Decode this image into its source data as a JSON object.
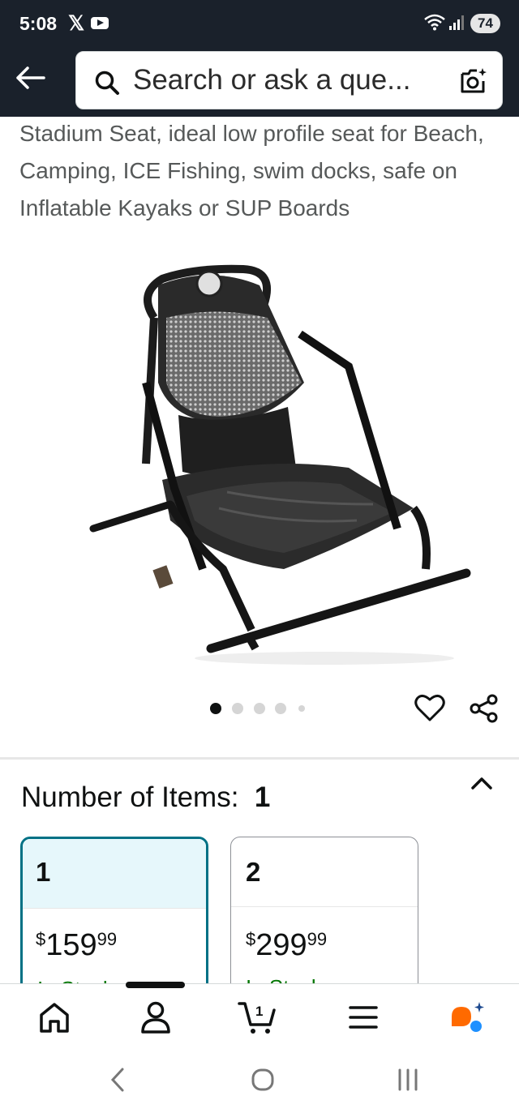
{
  "status_bar": {
    "time": "5:08",
    "x_glyph": "𝕏",
    "battery": "74",
    "icons": [
      "x-icon",
      "youtube-icon",
      "wifi-icon",
      "signal-icon"
    ]
  },
  "search": {
    "placeholder": "Search or ask a que..."
  },
  "product": {
    "title": "Stadium Seat, ideal low profile seat for Beach, Camping, ICE Fishing, swim docks, safe on Inflatable Kayaks or SUP Boards",
    "image_count": 5,
    "active_image": 1
  },
  "variation": {
    "label": "Number of Items:",
    "selected_value": "1",
    "options": [
      {
        "label": "1",
        "currency": "$",
        "price_whole": "159",
        "price_cents": "99",
        "stock": "In Stock",
        "selected": true
      },
      {
        "label": "2",
        "currency": "$",
        "price_whole": "299",
        "price_cents": "99",
        "stock": "In Stock",
        "selected": false
      }
    ]
  },
  "bottom_nav": {
    "items": [
      "home-icon",
      "account-icon",
      "cart-icon",
      "menu-icon",
      "rufus-icon"
    ],
    "cart_count": "1"
  },
  "colors": {
    "header_bg": "#1a212b",
    "selected_border": "#007185",
    "selected_bg": "#e6f7fb",
    "stock_green": "#007600",
    "rufus_orange": "#ff6a00",
    "rufus_blue": "#1e90ff"
  }
}
